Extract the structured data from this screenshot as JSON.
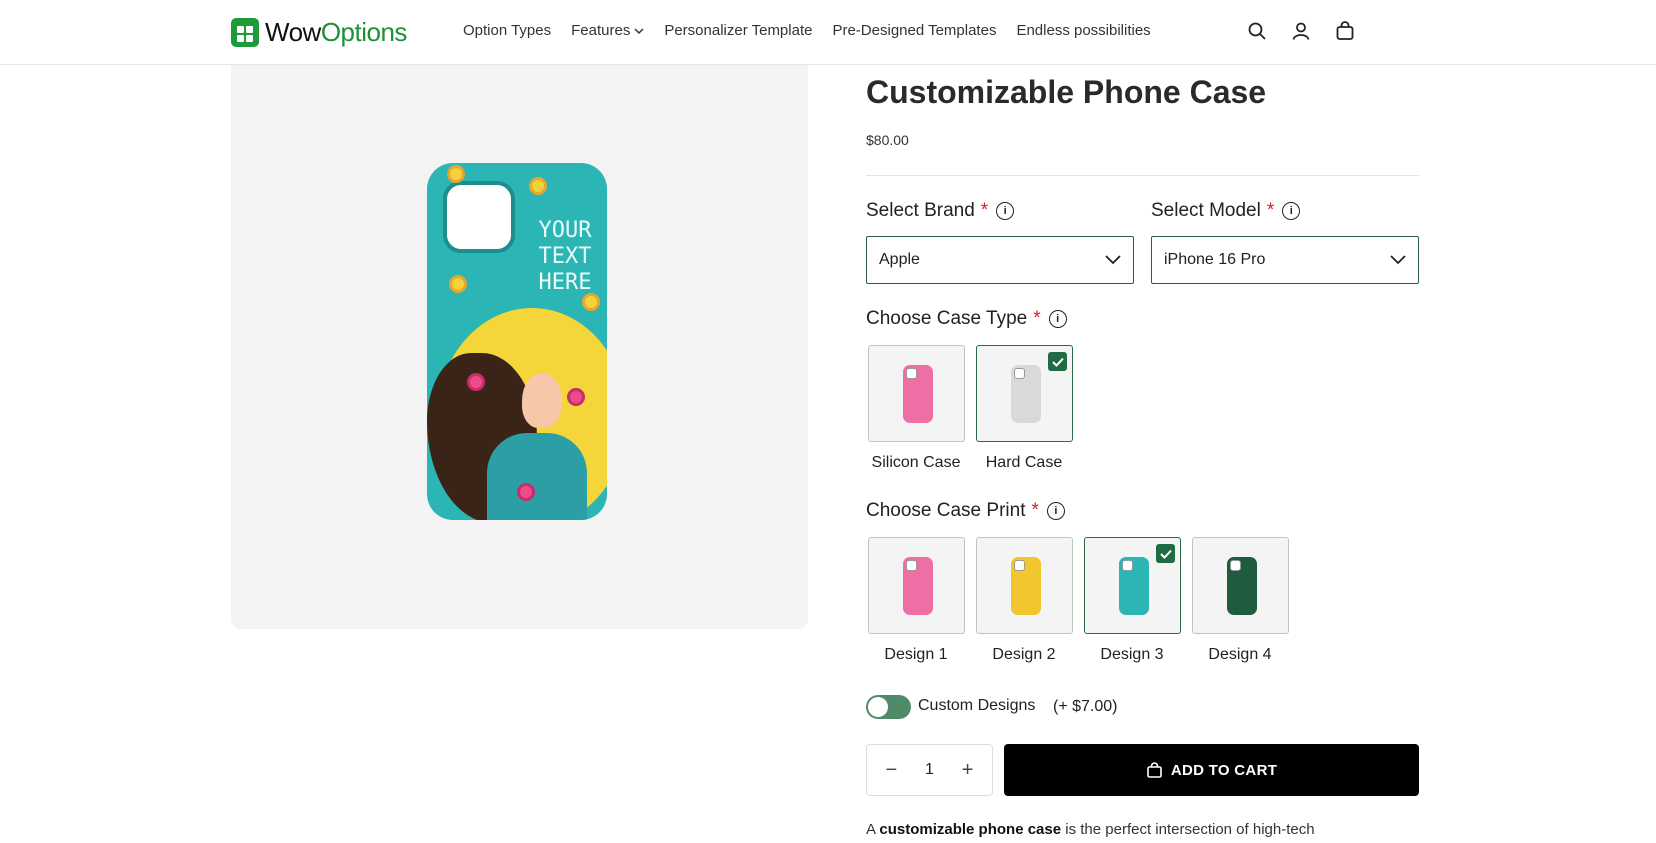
{
  "header": {
    "logo_wow": "Wow",
    "logo_options": "Options",
    "nav": [
      "Option Types",
      "Features",
      "Personalizer Template",
      "Pre-Designed Templates",
      "Endless possibilities"
    ]
  },
  "product": {
    "phone_text": "YOUR TEXT HERE",
    "title": "Customizable Phone Case",
    "price": "$80.00",
    "brand": {
      "label": "Select Brand",
      "value": "Apple"
    },
    "model": {
      "label": "Select Model",
      "value": "iPhone 16 Pro"
    },
    "case_type": {
      "label": "Choose Case Type",
      "options": [
        {
          "name": "Silicon Case",
          "color": "#ee6fa6",
          "selected": false
        },
        {
          "name": "Hard Case",
          "color": "#d9d9d9",
          "selected": true
        }
      ]
    },
    "case_print": {
      "label": "Choose Case Print",
      "options": [
        {
          "name": "Design 1",
          "color": "#ee6fa6",
          "selected": false
        },
        {
          "name": "Design 2",
          "color": "#f1c62e",
          "selected": false
        },
        {
          "name": "Design 3",
          "color": "#2bb5b5",
          "selected": true
        },
        {
          "name": "Design 4",
          "color": "#1f5b3d",
          "selected": false
        }
      ]
    },
    "custom_designs": {
      "label": "Custom Designs",
      "price": "(+ $7.00)",
      "on": false
    },
    "quantity": "1",
    "add_to_cart": "ADD TO CART",
    "description": {
      "pre": "A ",
      "bold": "customizable phone case",
      "post": " is the perfect intersection of high-tech"
    }
  },
  "colors": {
    "accent": "#1f8f38",
    "required": "#d2222d"
  }
}
